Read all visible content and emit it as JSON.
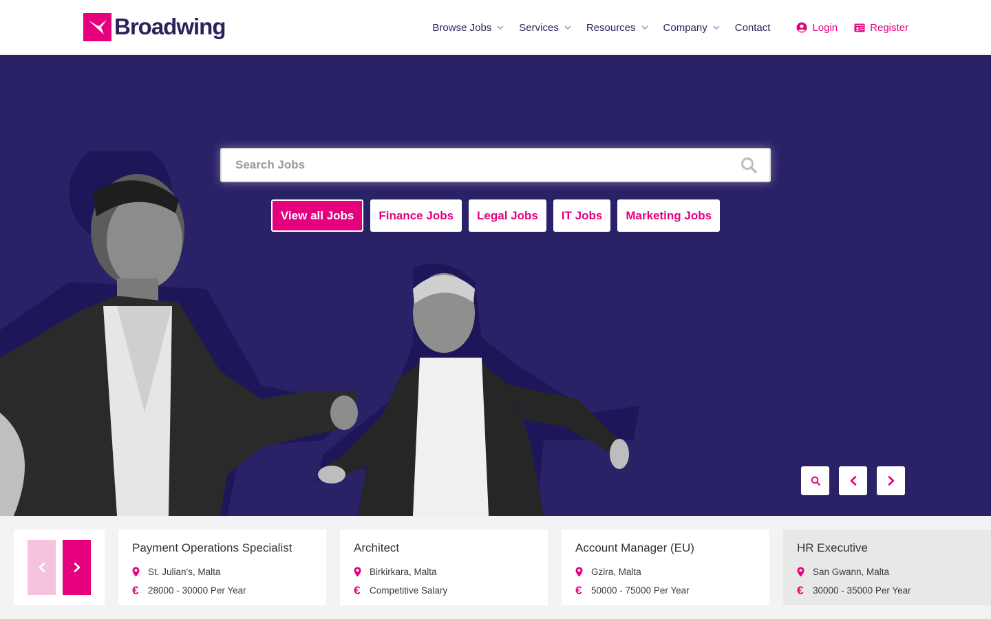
{
  "brand": {
    "name": "Broadwing",
    "accent": "#e6007e",
    "navy": "#29235c",
    "hero_bg": "#2a2266"
  },
  "nav": {
    "items": [
      {
        "label": "Browse Jobs",
        "dropdown": true
      },
      {
        "label": "Services",
        "dropdown": true
      },
      {
        "label": "Resources",
        "dropdown": true
      },
      {
        "label": "Company",
        "dropdown": true
      },
      {
        "label": "Contact",
        "dropdown": false
      }
    ],
    "login": {
      "label": "Login",
      "icon": "user-circle-icon"
    },
    "register": {
      "label": "Register",
      "icon": "id-card-icon"
    }
  },
  "hero": {
    "search": {
      "placeholder": "Search Jobs",
      "value": "",
      "icon": "search-icon"
    },
    "chips": [
      {
        "label": "View all Jobs",
        "active": true
      },
      {
        "label": "Finance Jobs",
        "active": false
      },
      {
        "label": "Legal Jobs",
        "active": false
      },
      {
        "label": "IT Jobs",
        "active": false
      },
      {
        "label": "Marketing Jobs",
        "active": false
      }
    ],
    "controls": [
      "search-icon",
      "chevron-left-icon",
      "chevron-right-icon"
    ]
  },
  "jobs": [
    {
      "title": "Payment Operations Specialist",
      "location": "St. Julian's, Malta",
      "salary": "28000 - 30000 Per Year"
    },
    {
      "title": "Architect",
      "location": "Birkirkara, Malta",
      "salary": "Competitive Salary"
    },
    {
      "title": "Account Manager (EU)",
      "location": "Gzira, Malta",
      "salary": "50000 - 75000 Per Year"
    },
    {
      "title": "HR Executive",
      "location": "San Gwann, Malta",
      "salary": "30000 - 35000 Per Year"
    }
  ],
  "icons": {
    "location": "map-pin-icon",
    "salary": "euro-icon",
    "salary_glyph": "€"
  }
}
